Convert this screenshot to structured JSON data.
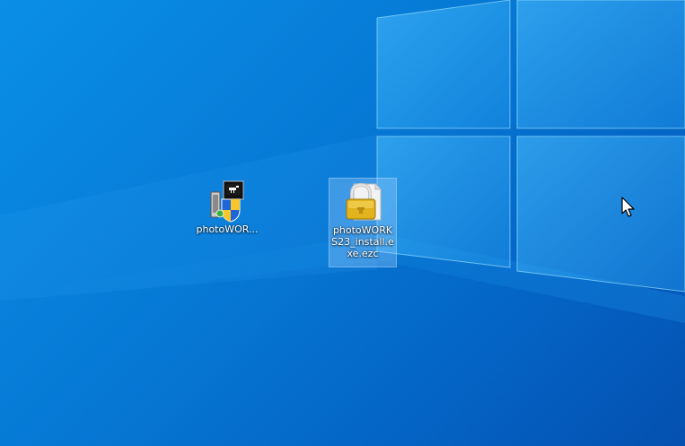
{
  "desktop": {
    "wallpaper": "windows-10-hero",
    "accent": "#0678d4",
    "icons": [
      {
        "label": "photoWOR...",
        "icon": "installer-shield-icon",
        "selected": false
      },
      {
        "label": "photoWORKS23_install.exe.ezc",
        "icon": "locked-file-icon",
        "selected": true
      }
    ]
  },
  "cursor": {
    "icon": "arrow-cursor-icon"
  }
}
